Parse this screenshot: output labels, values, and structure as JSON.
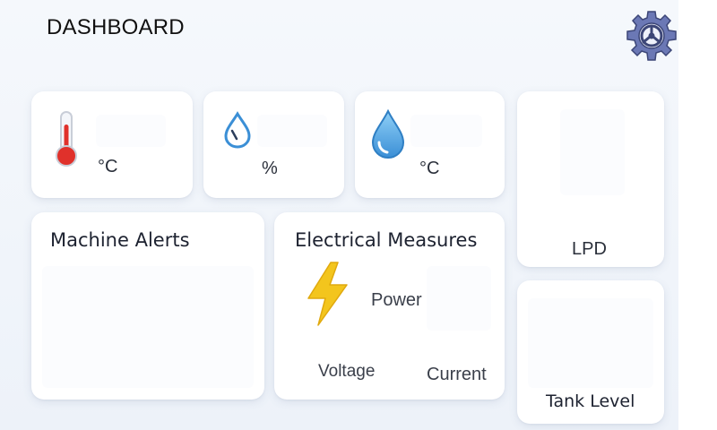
{
  "header": {
    "title": "DASHBOARD",
    "settings_icon": "gear-icon"
  },
  "colors": {
    "background": "#f1f5fa",
    "card": "#ffffff",
    "gear_fill": "#6b78b5",
    "thermometer_red": "#e0312b",
    "drop_blue": "#3b8fd6",
    "bolt_yellow": "#f3c51d"
  },
  "tiles": {
    "temperature": {
      "icon": "thermometer-icon",
      "unit": "°C"
    },
    "humidity": {
      "icon": "humidity-drop-icon",
      "unit": "%"
    },
    "water_temperature": {
      "icon": "water-drop-icon",
      "unit": "°C"
    },
    "flow": {
      "unit": "LPD"
    }
  },
  "machine_alerts": {
    "title": "Machine Alerts"
  },
  "electrical": {
    "title": "Electrical Measures",
    "icon": "lightning-bolt-icon",
    "power_label": "Power",
    "voltage_label": "Voltage",
    "current_label": "Current"
  },
  "tank": {
    "label": "Tank Level"
  }
}
